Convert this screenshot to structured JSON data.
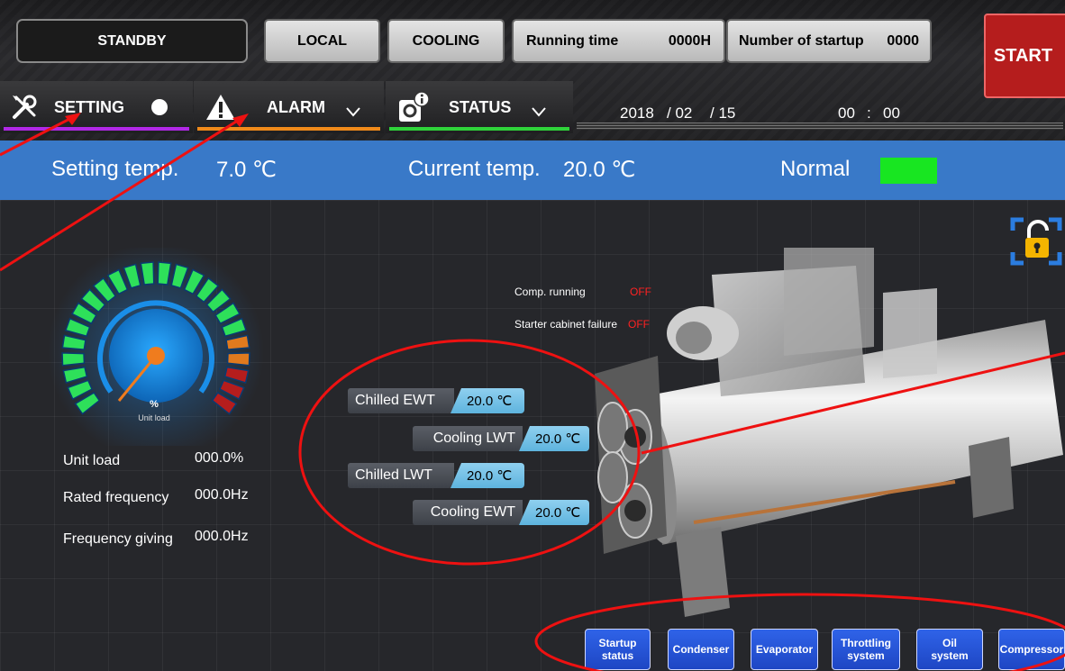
{
  "header": {
    "mode": "STANDBY",
    "control": "LOCAL",
    "operation": "COOLING",
    "running_time_label": "Running time",
    "running_time_value": "0000H",
    "startup_count_label": "Number of startup",
    "startup_count_value": "0000",
    "start_button": "START"
  },
  "menu": {
    "setting": "SETTING",
    "alarm": "ALARM",
    "status": "STATUS"
  },
  "datetime": {
    "year": "2018",
    "month_sep": "/ 02",
    "day_sep": "/ 15",
    "hour": "00",
    "colon": ":",
    "minute": "00"
  },
  "strip": {
    "setting_temp_label": "Setting temp.",
    "setting_temp_value": "7.0 ℃",
    "current_temp_label": "Current temp.",
    "current_temp_value": "20.0 ℃",
    "status_text": "Normal",
    "status_color": "#18e621"
  },
  "gauge": {
    "unit": "%",
    "caption": "Unit load",
    "load_fraction": 0.0
  },
  "unit_info": [
    {
      "label": "Unit load",
      "value": "000.0%"
    },
    {
      "label": "Rated frequency",
      "value": "000.0Hz"
    },
    {
      "label": "Frequency giving",
      "value": "000.0Hz"
    }
  ],
  "signals": [
    {
      "label": "Comp. running",
      "value": "OFF"
    },
    {
      "label": "Starter cabinet failure",
      "value": "OFF"
    }
  ],
  "temperatures": [
    {
      "label": "Chilled EWT",
      "value": "20.0 ℃"
    },
    {
      "label": "Cooling LWT",
      "value": "20.0 ℃"
    },
    {
      "label": "Chilled LWT",
      "value": "20.0 ℃"
    },
    {
      "label": "Cooling EWT",
      "value": "20.0 ℃"
    }
  ],
  "nav": {
    "startup_status_1": "Startup",
    "startup_status_2": "status",
    "condenser": "Condenser",
    "evaporator": "Evaporator",
    "throttling_1": "Throttling",
    "throttling_2": "system",
    "oil_1": "Oil",
    "oil_2": "system",
    "compressor": "Compressor"
  },
  "colors": {
    "accent_blue": "#3979c8",
    "alarm_red": "#b51d1d",
    "off_red": "#ff2222",
    "annotation_red": "#ee1111"
  },
  "icons": [
    "tools-icon",
    "warning-icon",
    "gear-info-icon",
    "chevron-down-icon",
    "padlock-icon",
    "dot-indicator-icon"
  ]
}
